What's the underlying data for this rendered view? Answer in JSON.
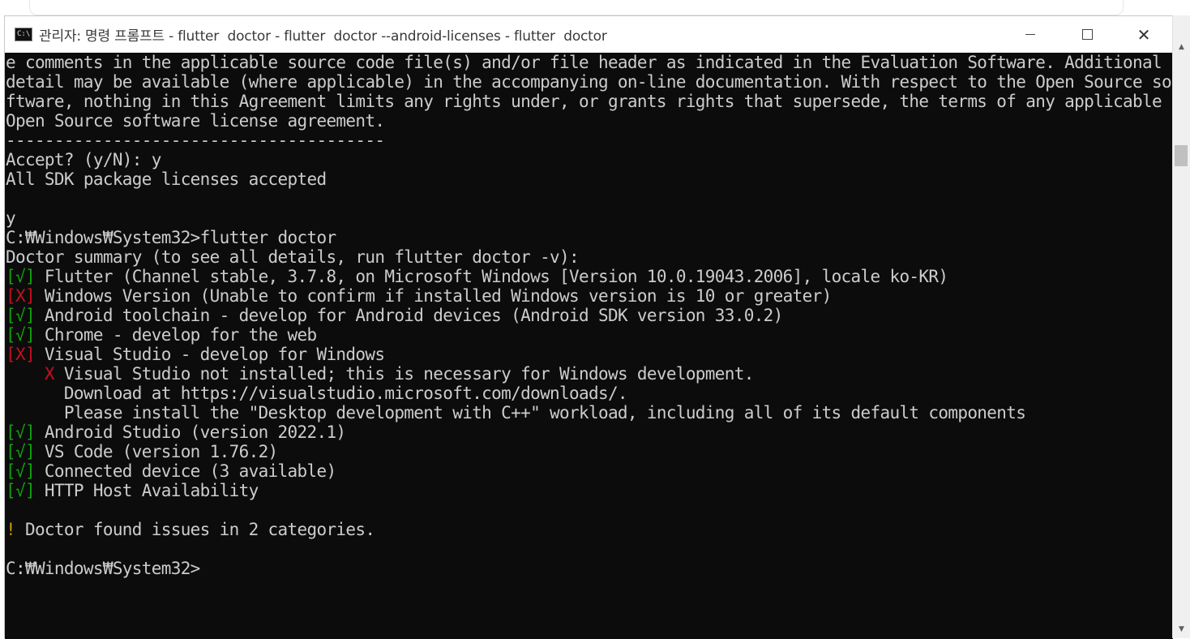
{
  "window": {
    "title": "관리자: 명령 프롬프트 - flutter  doctor - flutter  doctor --android-licenses - flutter  doctor",
    "icon": "cmd-icon",
    "icon_label": "C:\\",
    "buttons": {
      "minimize": "minimize-icon",
      "maximize": "maximize-icon",
      "close": "✕"
    }
  },
  "console": {
    "lines": {
      "l0": "e comments in the applicable source code file(s) and/or file header as indicated in the Evaluation Software. Additional",
      "l1": "detail may be available (where applicable) in the accompanying on-line documentation. With respect to the Open Source so",
      "l2": "ftware, nothing in this Agreement limits any rights under, or grants rights that supersede, the terms of any applicable",
      "l3": "Open Source software license agreement.",
      "l4": "---------------------------------------",
      "l5": "Accept? (y/N): y",
      "l6": "All SDK package licenses accepted",
      "l8": "y",
      "l9": "C:₩Windows₩System32>flutter doctor",
      "l10": "Doctor summary (to see all details, run flutter doctor -v):",
      "l11": " Flutter (Channel stable, 3.7.8, on Microsoft Windows [Version 10.0.19043.2006], locale ko-KR)",
      "l12": " Windows Version (Unable to confirm if installed Windows version is 10 or greater)",
      "l13": " Android toolchain - develop for Android devices (Android SDK version 33.0.2)",
      "l14": " Chrome - develop for the web",
      "l15": " Visual Studio - develop for Windows",
      "l16": " Visual Studio not installed; this is necessary for Windows development.",
      "l17": "      Download at https://visualstudio.microsoft.com/downloads/.",
      "l18": "      Please install the \"Desktop development with C++\" workload, including all of its default components",
      "l19": " Android Studio (version 2022.1)",
      "l20": " VS Code (version 1.76.2)",
      "l21": " Connected device (3 available)",
      "l22": " HTTP Host Availability",
      "l24": " Doctor found issues in 2 categories.",
      "l26": "C:₩Windows₩System32>"
    },
    "marks": {
      "ok": "[√]",
      "fail": "[X]",
      "x": "    X",
      "warn": "!"
    },
    "colors": {
      "text": "#cccccc",
      "ok": "#13a10e",
      "fail": "#c50f1f",
      "warn": "#c19c00",
      "background": "#0c0c0c"
    }
  },
  "scrollbar": {
    "up_arrow": "▲",
    "down_arrow": "▼"
  }
}
